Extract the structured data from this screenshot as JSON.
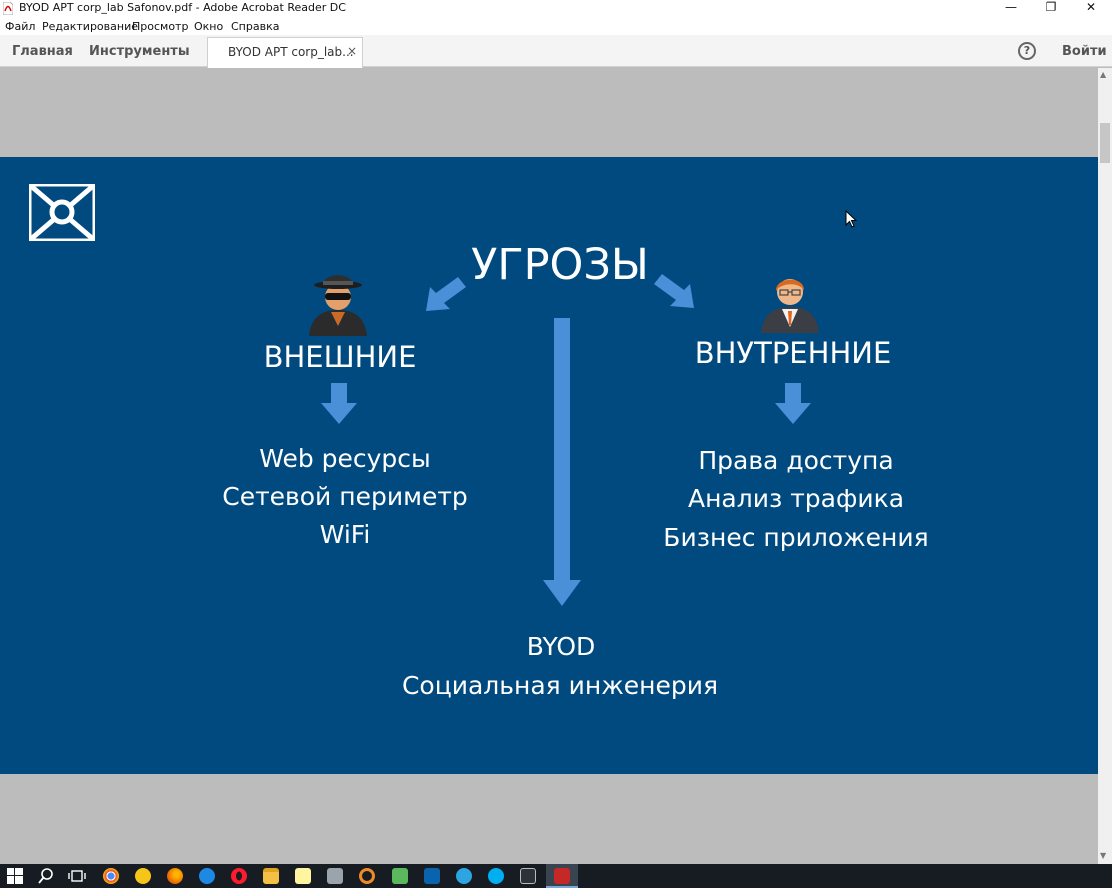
{
  "window": {
    "title": "BYOD APT corp_lab Safonov.pdf - Adobe Acrobat Reader DC",
    "minimize": "—",
    "restore": "❐",
    "close": "✕"
  },
  "menu": [
    "Файл",
    "Редактирование",
    "Просмотр",
    "Окно",
    "Справка"
  ],
  "tabs": {
    "home": "Главная",
    "tools": "Инструменты",
    "document": "BYOD APT corp_lab...",
    "close_glyph": "×",
    "help": "?",
    "signin": "Войти"
  },
  "scrollbar": {
    "up": "▲",
    "down": "▼"
  },
  "slide": {
    "heading": "УГРОЗЫ",
    "external": {
      "title": "ВНЕШНИЕ",
      "items": [
        "Web ресурсы",
        "Сетевой периметр",
        "WiFi"
      ]
    },
    "internal": {
      "title": "ВНУТРЕННИЕ",
      "items": [
        "Права доступа",
        "Анализ трафика",
        "Бизнес приложения"
      ]
    },
    "center": {
      "items": [
        "BYOD",
        "Социальная инженерия"
      ]
    },
    "icons": {
      "logo": "crossed-envelope-logo",
      "external_person": "spy-hacker-icon",
      "internal_person": "businessman-icon"
    },
    "colors": {
      "background": "#004a80",
      "arrow": "#4a90d9",
      "text": "#ffffff"
    }
  },
  "taskbar": {
    "icons": [
      "windows-start-icon",
      "search-icon",
      "task-view-icon",
      "chrome-icon",
      "yandex-icon",
      "firefox-icon",
      "edge-icon",
      "opera-icon",
      "file-explorer-icon",
      "notepad-icon",
      "network-tool-icon",
      "headphones-icon",
      "utorrent-icon",
      "outlook-icon",
      "telegram-icon",
      "skype-icon",
      "unity-icon",
      "acrobat-icon"
    ]
  }
}
